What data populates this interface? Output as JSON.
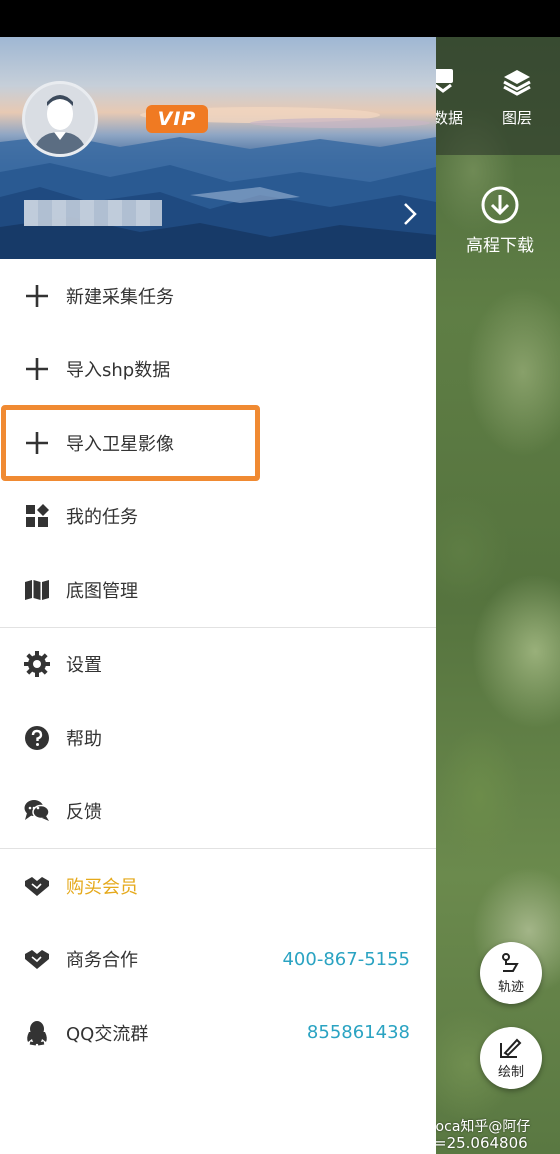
{
  "header": {
    "vip_badge": "VIP"
  },
  "menu": {
    "new_task": "新建采集任务",
    "import_shp": "导入shp数据",
    "import_satellite": "导入卫星影像",
    "my_tasks": "我的任务",
    "basemap": "底图管理",
    "settings": "设置",
    "help": "帮助",
    "feedback": "反馈",
    "buy_vip": "购买会员",
    "business": "商务合作",
    "business_phone": "400-867-5155",
    "qq_group": "QQ交流群",
    "qq_number": "855861438"
  },
  "map": {
    "data_label": "数据",
    "layers_label": "图层",
    "elevation_label": "高程下载",
    "track_label": "轨迹",
    "draw_label": "绘制",
    "watermark_text": "Loca知乎@阿仔",
    "coordinate": "=25.064806"
  },
  "colors": {
    "accent_orange": "#f08a32",
    "vip_gold": "#e5a91b",
    "link_teal": "#2aa3c2",
    "icon_dark": "#333333"
  },
  "icons": [
    "plus-icon",
    "grid-icon",
    "map-icon",
    "gear-icon",
    "question-icon",
    "chat-icon",
    "handshake-icon",
    "qq-penguin-icon",
    "chevron-right-icon",
    "layers-icon",
    "download-icon",
    "track-icon",
    "draw-icon"
  ]
}
